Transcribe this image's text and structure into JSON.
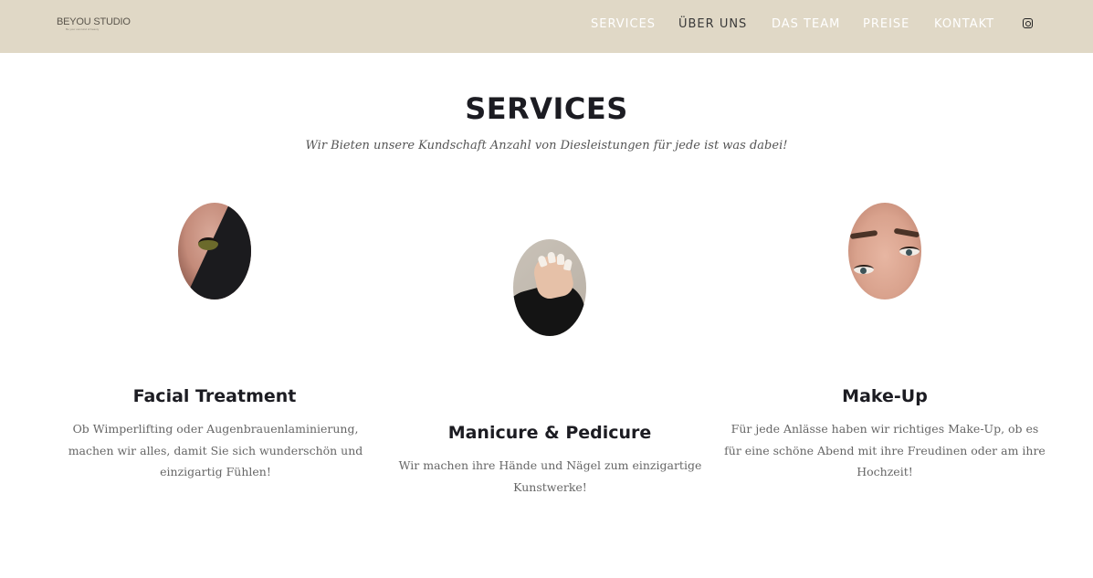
{
  "header": {
    "logo_text": "BEYOU STUDIO",
    "logo_tagline": "Be your own kind of beauty",
    "nav": [
      {
        "label": "SERVICES"
      },
      {
        "label": "ÜBER UNS"
      },
      {
        "label": "DAS TEAM"
      },
      {
        "label": "PREISE"
      },
      {
        "label": "KONTAKT"
      }
    ],
    "social_icon": "instagram-icon"
  },
  "services": {
    "title": "SERVICES",
    "subtitle": "Wir Bieten unsere Kundschaft Anzahl von Diesleistungen für jede ist was dabei!",
    "cards": [
      {
        "title": "Facial Treatment",
        "text": "Ob Wimperlifting oder Augenbrauenlaminierung, machen wir alles, damit Sie sich wunderschön und einzigartig Fühlen!",
        "image": "eyelash-photo"
      },
      {
        "title": "Manicure & Pedicure",
        "text": "Wir machen ihre Hände und Nägel zum einzigartige Kunstwerke!",
        "image": "manicure-photo"
      },
      {
        "title": "Make-Up",
        "text": "Für jede Anlässe haben wir richtiges Make-Up, ob es für eine schöne Abend mit ihre Freudinen oder am ihre Hochzeit!",
        "image": "makeup-photo"
      }
    ]
  },
  "colors": {
    "header_bg": "#e0d8c6",
    "nav_text": "#ffffff",
    "nav_active": "#3a3a3a",
    "heading": "#1c1c22",
    "body_text": "#666666"
  }
}
